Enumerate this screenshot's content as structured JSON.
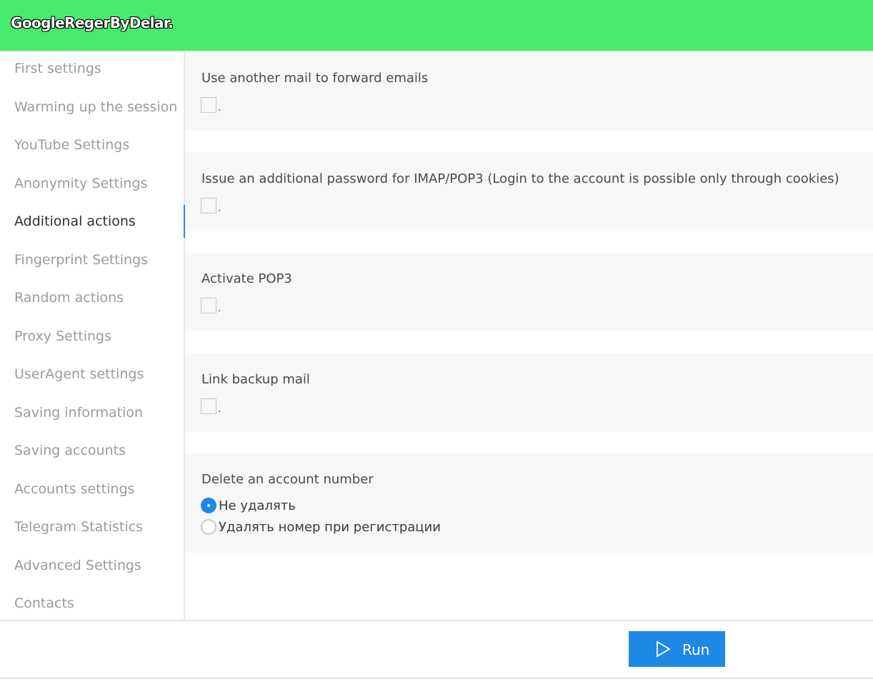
{
  "app": {
    "title": "GoogleRegerByDelar."
  },
  "colors": {
    "header_bg": "#48ea6d",
    "accent": "#1e88e5",
    "card_bg": "#f7f7f7",
    "inactive_text": "#9b9b9b"
  },
  "sidebar": {
    "items": [
      {
        "label": "First settings",
        "active": false
      },
      {
        "label": "Warming up the session",
        "active": false
      },
      {
        "label": "YouTube Settings",
        "active": false
      },
      {
        "label": "Anonymity Settings",
        "active": false
      },
      {
        "label": "Additional actions",
        "active": true
      },
      {
        "label": "Fingerprint Settings",
        "active": false
      },
      {
        "label": "Random actions",
        "active": false
      },
      {
        "label": "Proxy Settings",
        "active": false
      },
      {
        "label": "UserAgent settings",
        "active": false
      },
      {
        "label": "Saving information",
        "active": false
      },
      {
        "label": "Saving accounts",
        "active": false
      },
      {
        "label": "Accounts settings",
        "active": false
      },
      {
        "label": "Telegram Statistics",
        "active": false
      },
      {
        "label": "Advanced Settings",
        "active": false
      },
      {
        "label": "Contacts",
        "active": false
      }
    ]
  },
  "main": {
    "options": [
      {
        "title": "Use another mail to forward emails",
        "checked": false,
        "suffix": "."
      },
      {
        "title": "Issue an additional password for IMAP/POP3 (Login to the account is possible only through cookies)",
        "checked": false,
        "suffix": "."
      },
      {
        "title": "Activate POP3",
        "checked": false,
        "suffix": "."
      },
      {
        "title": "Link backup mail",
        "checked": false,
        "suffix": "."
      }
    ],
    "delete_number": {
      "title": "Delete an account number",
      "choices": [
        {
          "label": "Не удалять",
          "selected": true
        },
        {
          "label": "Удалять номер при регистрации",
          "selected": false
        }
      ]
    }
  },
  "footer": {
    "run_label": "Run",
    "run_icon": "play-outline-icon"
  }
}
